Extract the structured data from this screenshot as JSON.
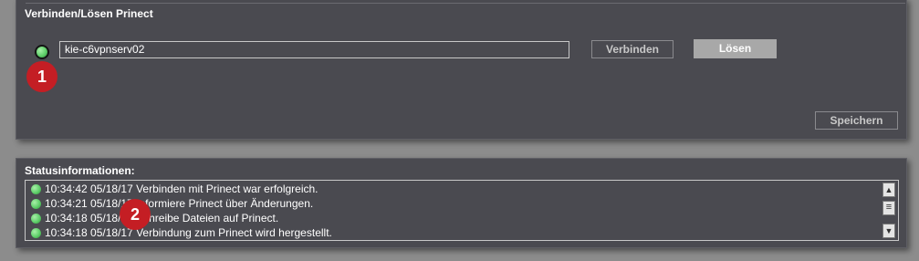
{
  "connect_panel": {
    "title": "Verbinden/Lösen Prinect",
    "status_led_color": "#5fcf6a",
    "host_value": "kie-c6vpnserv02",
    "connect_label": "Verbinden",
    "disconnect_label": "Lösen",
    "save_label": "Speichern"
  },
  "status_panel": {
    "title": "Statusinformationen:",
    "entries": [
      {
        "text": "10:34:42 05/18/17 Verbinden mit Prinect war erfolgreich.",
        "status_color": "#5fcf6a"
      },
      {
        "text": "10:34:21 05/18/17 Informiere Prinect über Änderungen.",
        "status_color": "#5fcf6a"
      },
      {
        "text": "10:34:18 05/18/17 Schreibe Dateien auf Prinect.",
        "status_color": "#5fcf6a"
      },
      {
        "text": "10:34:18 05/18/17 Verbindung zum Prinect wird hergestellt.",
        "status_color": "#5fcf6a"
      }
    ],
    "scroll_up_icon": "arrow-up-icon",
    "scroll_thumb_icon": "grip-lines-icon",
    "scroll_down_icon": "arrow-down-icon"
  },
  "callouts": {
    "one": "1",
    "two": "2",
    "color": "#c41e24"
  }
}
